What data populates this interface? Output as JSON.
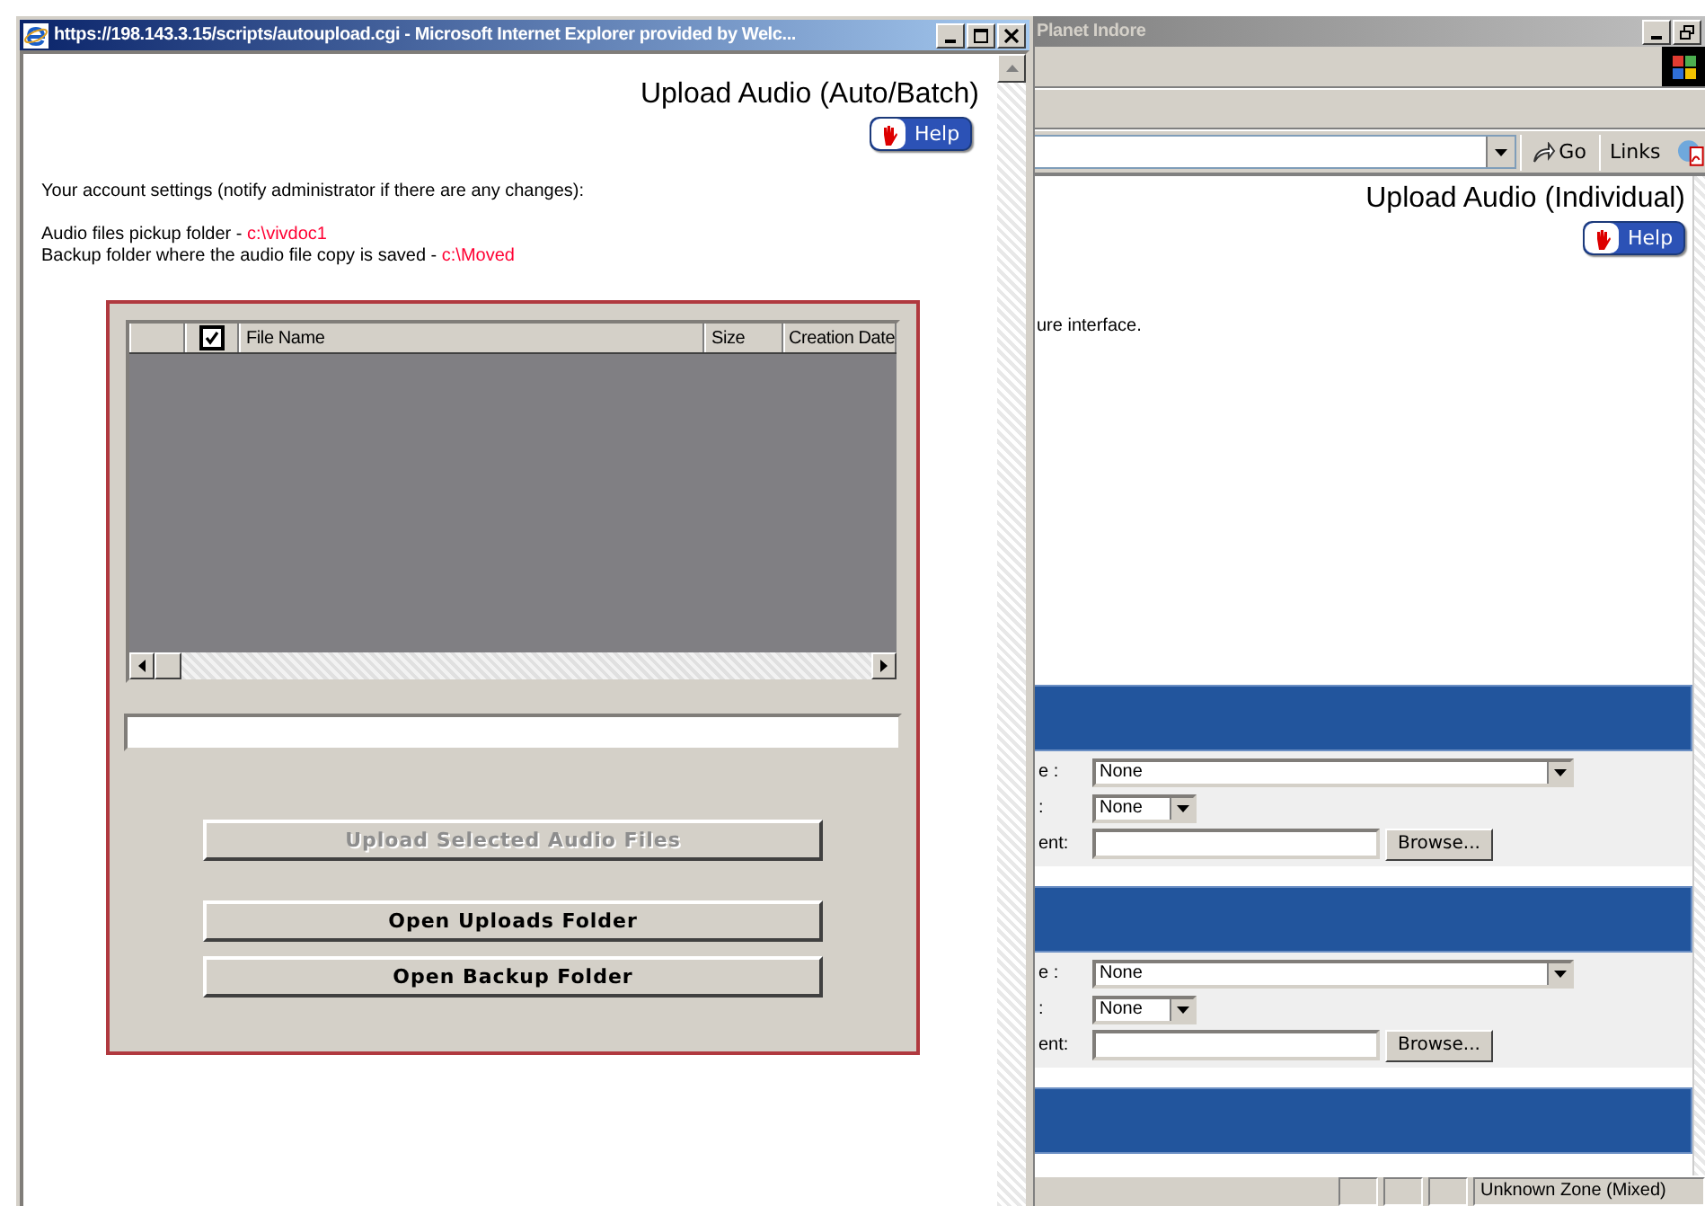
{
  "front_window": {
    "title": "https://198.143.3.15/scripts/autoupload.cgi - Microsoft Internet Explorer provided by Welc...",
    "heading": "Upload Audio (Auto/Batch)",
    "help_button": "Help",
    "account_note": "Your account settings (notify administrator if there are any changes):",
    "settings": [
      {
        "label": "Audio files pickup folder - ",
        "value": "c:\\vivdoc1"
      },
      {
        "label": "Backup folder where the audio file copy is saved - ",
        "value": "c:\\Moved"
      }
    ],
    "file_table": {
      "columns": [
        {
          "kind": "blank"
        },
        {
          "kind": "checkbox",
          "checked": true
        },
        {
          "kind": "text",
          "label": "File Name"
        },
        {
          "kind": "text",
          "label": "Size"
        },
        {
          "kind": "text",
          "label": "Creation Date"
        }
      ]
    },
    "buttons": [
      {
        "label": "Upload Selected Audio Files",
        "disabled": true
      },
      {
        "label": "Open Uploads Folder",
        "disabled": false
      },
      {
        "label": "Open Backup Folder",
        "disabled": false
      }
    ]
  },
  "back_window": {
    "title": "Planet Indore",
    "go_button": "Go",
    "links_button": "Links",
    "heading": "Upload Audio (Individual)",
    "help_button": "Help",
    "note": "ure interface.",
    "sections": [
      {
        "kind": "form",
        "rows": [
          {
            "kind": "select-wide",
            "label": "e :",
            "value": "None"
          },
          {
            "kind": "select-narrow",
            "label": ":",
            "value": "None"
          },
          {
            "kind": "file",
            "label": "ent:",
            "button": "Browse..."
          }
        ]
      },
      {
        "kind": "form",
        "rows": [
          {
            "kind": "select-wide",
            "label": "e :",
            "value": "None"
          },
          {
            "kind": "select-narrow",
            "label": ":",
            "value": "None"
          },
          {
            "kind": "file",
            "label": "ent:",
            "button": "Browse..."
          }
        ]
      },
      {
        "kind": "header-only"
      }
    ],
    "status_bar": {
      "zone": "Unknown Zone (Mixed)"
    }
  }
}
